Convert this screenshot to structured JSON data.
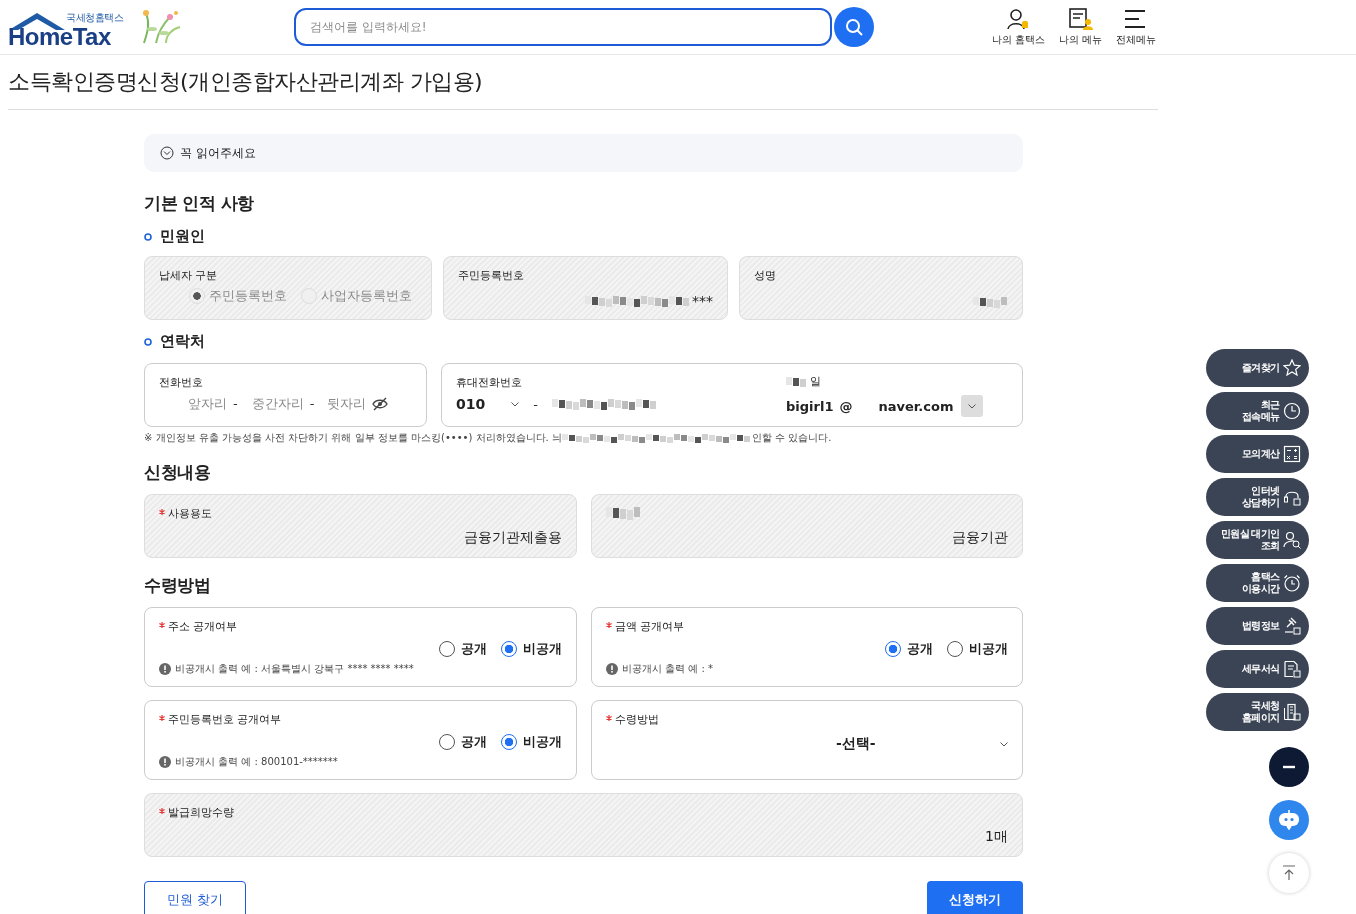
{
  "header": {
    "logo_caption": "국세청홈택스",
    "logo_text": "HomeTax",
    "search": {
      "placeholder": "검색어를 입력하세요!"
    },
    "nav": [
      {
        "label": "나의 홈택스"
      },
      {
        "label": "나의 메뉴"
      },
      {
        "label": "전체메뉴"
      }
    ]
  },
  "page_title": "소득확인증명신청(개인종합자산관리계좌 가입용)",
  "notice": {
    "label": "꼭 읽어주세요",
    "expanded": false
  },
  "section_title": "기본 인적 사항",
  "applicant": {
    "heading": "민원인",
    "fields": [
      {
        "kind": "radio",
        "label": "납세자 구분",
        "disabled": true,
        "options": [
          {
            "label": "주민등록번호",
            "selected": true
          },
          {
            "label": "사업자등록번호",
            "selected": false
          }
        ]
      },
      {
        "kind": "masked",
        "label": "주민등록번호",
        "value": "***"
      },
      {
        "kind": "masked",
        "label": "성명"
      }
    ]
  },
  "contact": {
    "heading": "연락처",
    "phone": {
      "label": "전화번호",
      "parts": [
        {
          "placeholder": "앞자리",
          "separator": "-"
        },
        {
          "placeholder": "중간자리",
          "separator": "-"
        },
        {
          "placeholder": "뒷자리"
        }
      ]
    },
    "mobile": {
      "label": "휴대전화번호",
      "prefix": "010",
      "separator": "-"
    },
    "email": {
      "label": "일",
      "id": "bigirl1",
      "at": "@",
      "domain": "naver.com"
    },
    "note_start": "※ 개인정보 유출 가능성을 사전 차단하기 위해 일부 정보를 마스킹(••••) 처리하였습니다. 늬",
    "note_end": "인할 수 있습니다."
  },
  "request": {
    "heading": "신청내용",
    "fields": [
      {
        "kind": "text",
        "required": true,
        "label": "사용용도",
        "value": "금융기관제출용"
      },
      {
        "kind": "masked",
        "value": "금융기관"
      }
    ]
  },
  "receipt": {
    "heading": "수령방법",
    "fields": [
      {
        "kind": "radio",
        "required": true,
        "label": "주소 공개여부",
        "hint": "비공개시 출력 예 : 서울특별시 강북구 **** **** ****",
        "options": [
          {
            "label": "공개",
            "selected": false
          },
          {
            "label": "비공개",
            "selected": true
          }
        ]
      },
      {
        "kind": "radio",
        "required": true,
        "label": "금액 공개여부",
        "hint": "비공개시 출력 예 : *",
        "options": [
          {
            "label": "공개",
            "selected": true
          },
          {
            "label": "비공개",
            "selected": false
          }
        ]
      },
      {
        "kind": "radio",
        "required": true,
        "label": "주민등록번호 공개여부",
        "hint": "비공개시 출력 예 : 800101-*******",
        "options": [
          {
            "label": "공개",
            "selected": false
          },
          {
            "label": "비공개",
            "selected": true
          }
        ]
      },
      {
        "kind": "select",
        "required": true,
        "label": "수령방법",
        "value": "-선택-"
      }
    ]
  },
  "quantity": {
    "required": true,
    "label": "발급희망수량",
    "value": "1매"
  },
  "buttons": [
    {
      "label": "민원 찾기",
      "kind": "secondary"
    },
    {
      "label": "신청하기",
      "kind": "primary"
    }
  ],
  "quick_menu": [
    {
      "label": "즐겨찾기"
    },
    {
      "label": "최근\n접속메뉴"
    },
    {
      "label": "모의계산"
    },
    {
      "label": "인터넷\n상담하기"
    },
    {
      "label": "민원실 대기인\n조회"
    },
    {
      "label": "홈택스\n이용시간"
    },
    {
      "label": "법령정보"
    },
    {
      "label": "세무서식"
    },
    {
      "label": "국세청\n홈페이지"
    }
  ],
  "float_buttons": [
    {
      "kind": "collapse"
    },
    {
      "kind": "chatbot"
    },
    {
      "kind": "top"
    }
  ]
}
